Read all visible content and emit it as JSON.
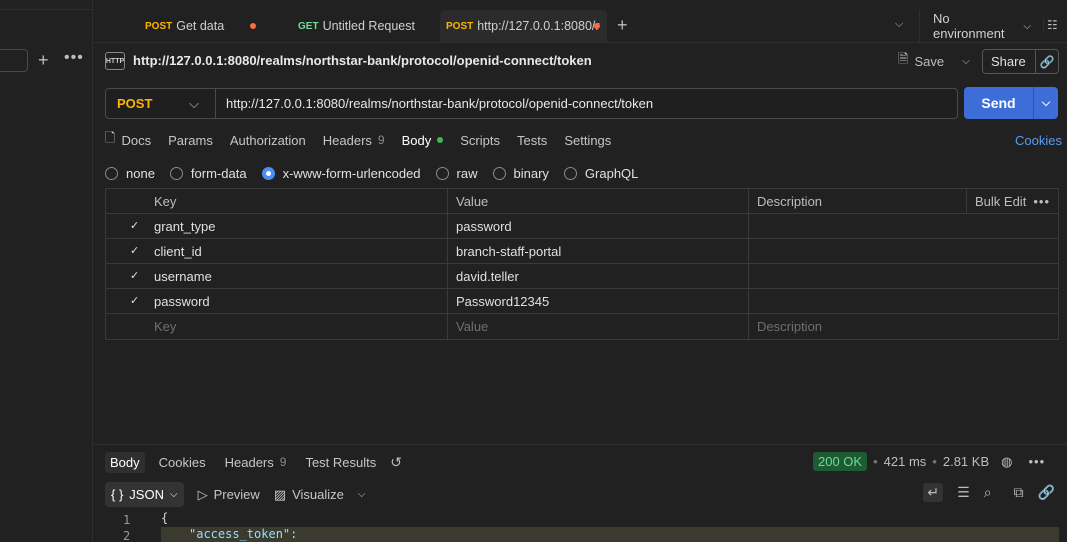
{
  "tabs": [
    {
      "method": "POST",
      "label": "Get data",
      "unsaved": true
    },
    {
      "method": "GET",
      "label": "Untitled Request",
      "unsaved": false
    },
    {
      "method": "POST",
      "label": "http://127.0.0.1:8080/r",
      "unsaved": true,
      "active": true
    }
  ],
  "new_tab_label": "+",
  "environment": {
    "selected": "No environment"
  },
  "request": {
    "icon_text": "HTTP",
    "title": "http://127.0.0.1:8080/realms/northstar-bank/protocol/openid-connect/token",
    "save_label": "Save",
    "share_label": "Share",
    "method": "POST",
    "url": "http://127.0.0.1:8080/realms/northstar-bank/protocol/openid-connect/token",
    "send_label": "Send"
  },
  "request_tabs": {
    "docs": "Docs",
    "params": "Params",
    "authorization": "Authorization",
    "headers": "Headers",
    "headers_count": "9",
    "body": "Body",
    "scripts": "Scripts",
    "tests": "Tests",
    "settings": "Settings",
    "cookies": "Cookies"
  },
  "body_types": {
    "none": "none",
    "form_data": "form-data",
    "urlencoded": "x-www-form-urlencoded",
    "raw": "raw",
    "binary": "binary",
    "graphql": "GraphQL",
    "selected": "x-www-form-urlencoded"
  },
  "table": {
    "headers": {
      "key": "Key",
      "value": "Value",
      "description": "Description",
      "bulk_edit": "Bulk Edit"
    },
    "rows": [
      {
        "checked": true,
        "key": "grant_type",
        "value": "password",
        "description": ""
      },
      {
        "checked": true,
        "key": "client_id",
        "value": "branch-staff-portal",
        "description": ""
      },
      {
        "checked": true,
        "key": "username",
        "value": "david.teller",
        "description": ""
      },
      {
        "checked": true,
        "key": "password",
        "value": "Password12345",
        "description": ""
      }
    ],
    "placeholders": {
      "key": "Key",
      "value": "Value",
      "description": "Description"
    }
  },
  "response": {
    "tabs": {
      "body": "Body",
      "cookies": "Cookies",
      "headers": "Headers",
      "headers_count": "9",
      "test_results": "Test Results"
    },
    "status": "200 OK",
    "time": "421 ms",
    "size": "2.81 KB",
    "format": "JSON",
    "preview": "Preview",
    "visualize": "Visualize",
    "lines": [
      {
        "num": "1",
        "text": "{"
      },
      {
        "num": "2",
        "text": "\"access_token\":"
      }
    ]
  }
}
